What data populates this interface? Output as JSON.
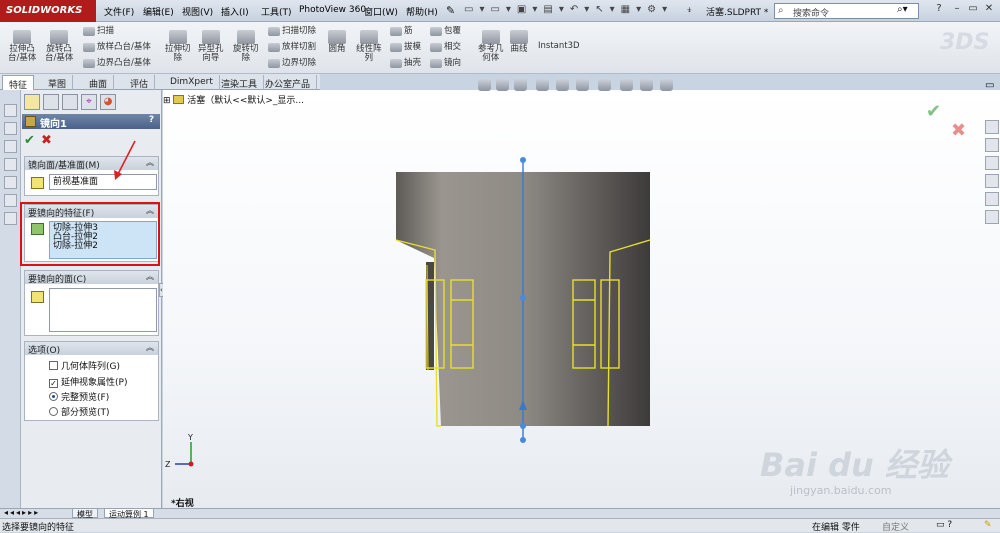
{
  "app": {
    "logo": "SOLIDWORKS",
    "doc_title": "活塞.SLDPRT *"
  },
  "menu": [
    "文件(F)",
    "编辑(E)",
    "视图(V)",
    "插入(I)",
    "工具(T)",
    "PhotoView 360",
    "窗口(W)",
    "帮助(H)"
  ],
  "search": {
    "placeholder": "搜索命令"
  },
  "commands": {
    "extrude_boss": "拉伸凸\n台/基体",
    "revolve_boss": "旋转凸\n台/基体",
    "sweep": "扫描",
    "loft_boss": "放样凸台/基体",
    "boundary_boss": "边界凸台/基体",
    "extrude_cut": "拉伸切\n除",
    "hole_wizard": "异型孔\n向导",
    "revolve_cut": "旋转切\n除",
    "swept_cut": "扫描切除",
    "lofted_cut": "放样切割",
    "boundary_cut": "边界切除",
    "fillet": "圆角",
    "linear_pattern": "线性阵\n列",
    "rib": "筋",
    "draft": "拔模",
    "shell": "抽壳",
    "wrap": "包覆",
    "intersect": "相交",
    "mirror": "镜向",
    "ref_geometry": "参考几\n何体",
    "curves": "曲线",
    "instant3d": "Instant3D"
  },
  "tabs": [
    "特征",
    "草图",
    "曲面",
    "评估",
    "DimXpert",
    "渲染工具",
    "办公室产品"
  ],
  "active_tab": 0,
  "property_manager": {
    "title": "镜向1",
    "help": "?",
    "mirror_face_header": "镜向面/基准面(M)",
    "mirror_face_value": "前视基准面",
    "features_header": "要镜向的特征(F)",
    "features": [
      "切除-拉伸3",
      "凸台-拉伸2",
      "切除-拉伸2"
    ],
    "faces_header": "要镜向的面(C)",
    "options_header": "选项(O)",
    "opt_geometry_pattern": "几何体阵列(G)",
    "opt_propagate": "延伸视象属性(P)",
    "opt_full_preview": "完整预览(F)",
    "opt_partial_preview": "部分预览(T)",
    "geometry_pattern_checked": false,
    "propagate_checked": true,
    "full_preview_selected": true
  },
  "graphics": {
    "tree_root": "活塞（默认<<默认>_显示...",
    "view_name": "*右视"
  },
  "bottom_tabs": [
    "模型",
    "运动算例 1"
  ],
  "status": {
    "left": "选择要镜向的特征",
    "editing": "在编辑 零件",
    "custom": "自定义"
  },
  "watermark": {
    "baidu": "Bai du 经验",
    "url": "jingyan.baidu.com"
  }
}
